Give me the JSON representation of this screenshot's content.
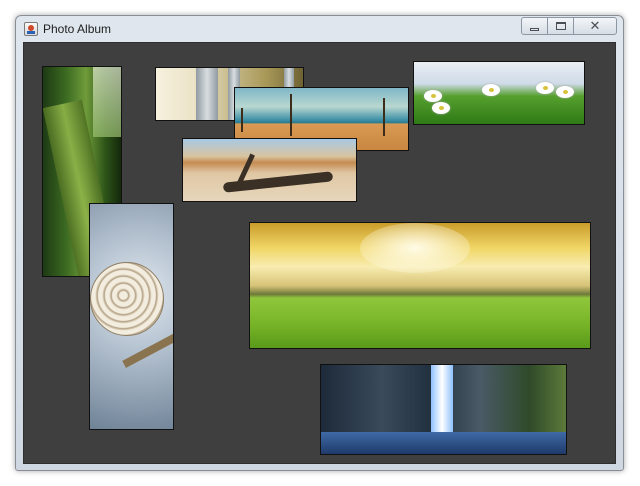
{
  "window": {
    "title": "Photo Album",
    "controls": {
      "minimize": "",
      "maximize": "",
      "close": "✕"
    }
  },
  "album": {
    "background": "#3f3f3f",
    "photos": [
      "forest",
      "birch-trees",
      "beach",
      "daisies",
      "desert",
      "snail",
      "field",
      "waterfall"
    ]
  }
}
